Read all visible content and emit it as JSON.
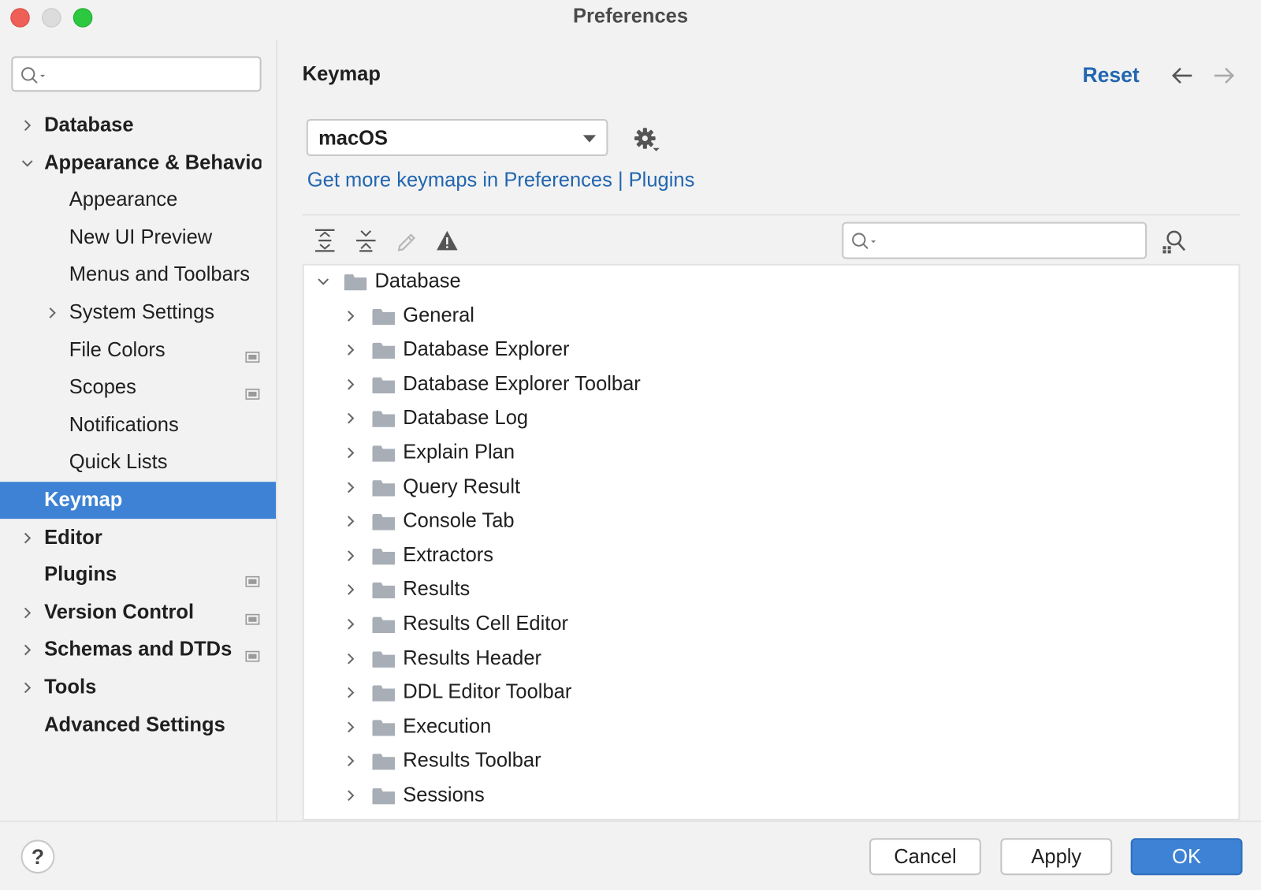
{
  "window": {
    "title": "Preferences"
  },
  "sidebar": {
    "search": {
      "placeholder": ""
    },
    "items": [
      {
        "label": "Database",
        "level": "top",
        "expandable": true,
        "expanded": false
      },
      {
        "label": "Appearance & Behavior",
        "level": "top",
        "expandable": true,
        "expanded": true
      },
      {
        "label": "Appearance",
        "level": "sub"
      },
      {
        "label": "New UI Preview",
        "level": "sub"
      },
      {
        "label": "Menus and Toolbars",
        "level": "sub"
      },
      {
        "label": "System Settings",
        "level": "sub",
        "expandable": true
      },
      {
        "label": "File Colors",
        "level": "sub",
        "project_icon": true
      },
      {
        "label": "Scopes",
        "level": "sub",
        "project_icon": true
      },
      {
        "label": "Notifications",
        "level": "sub"
      },
      {
        "label": "Quick Lists",
        "level": "sub"
      },
      {
        "label": "Keymap",
        "level": "top",
        "selected": true
      },
      {
        "label": "Editor",
        "level": "top",
        "expandable": true
      },
      {
        "label": "Plugins",
        "level": "top",
        "project_icon": true
      },
      {
        "label": "Version Control",
        "level": "top",
        "expandable": true,
        "project_icon": true
      },
      {
        "label": "Schemas and DTDs",
        "level": "top",
        "expandable": true,
        "project_icon": true
      },
      {
        "label": "Tools",
        "level": "top",
        "expandable": true
      },
      {
        "label": "Advanced Settings",
        "level": "top"
      }
    ]
  },
  "main": {
    "title": "Keymap",
    "reset_label": "Reset",
    "keymap_select": {
      "value": "macOS"
    },
    "plugins_link": "Get more keymaps in Preferences | Plugins",
    "tree_search": {
      "placeholder": ""
    },
    "tree": {
      "root": "Database",
      "children": [
        "General",
        "Database Explorer",
        "Database Explorer Toolbar",
        "Database Log",
        "Explain Plan",
        "Query Result",
        "Console Tab",
        "Extractors",
        "Results",
        "Results Cell Editor",
        "Results Header",
        "DDL Editor Toolbar",
        "Execution",
        "Results Toolbar",
        "Sessions"
      ]
    }
  },
  "footer": {
    "help_label": "?",
    "cancel_label": "Cancel",
    "apply_label": "Apply",
    "ok_label": "OK"
  },
  "colors": {
    "accent": "#3d82d4",
    "link": "#2266b0",
    "close": "#ee5f57",
    "maximize": "#2bc840"
  },
  "icons": {
    "toolbar": [
      "expand-all-icon",
      "collapse-all-icon",
      "edit-icon",
      "warning-icon"
    ],
    "find_by_shortcut": "find-shortcut-icon",
    "settings": "gear-icon"
  }
}
